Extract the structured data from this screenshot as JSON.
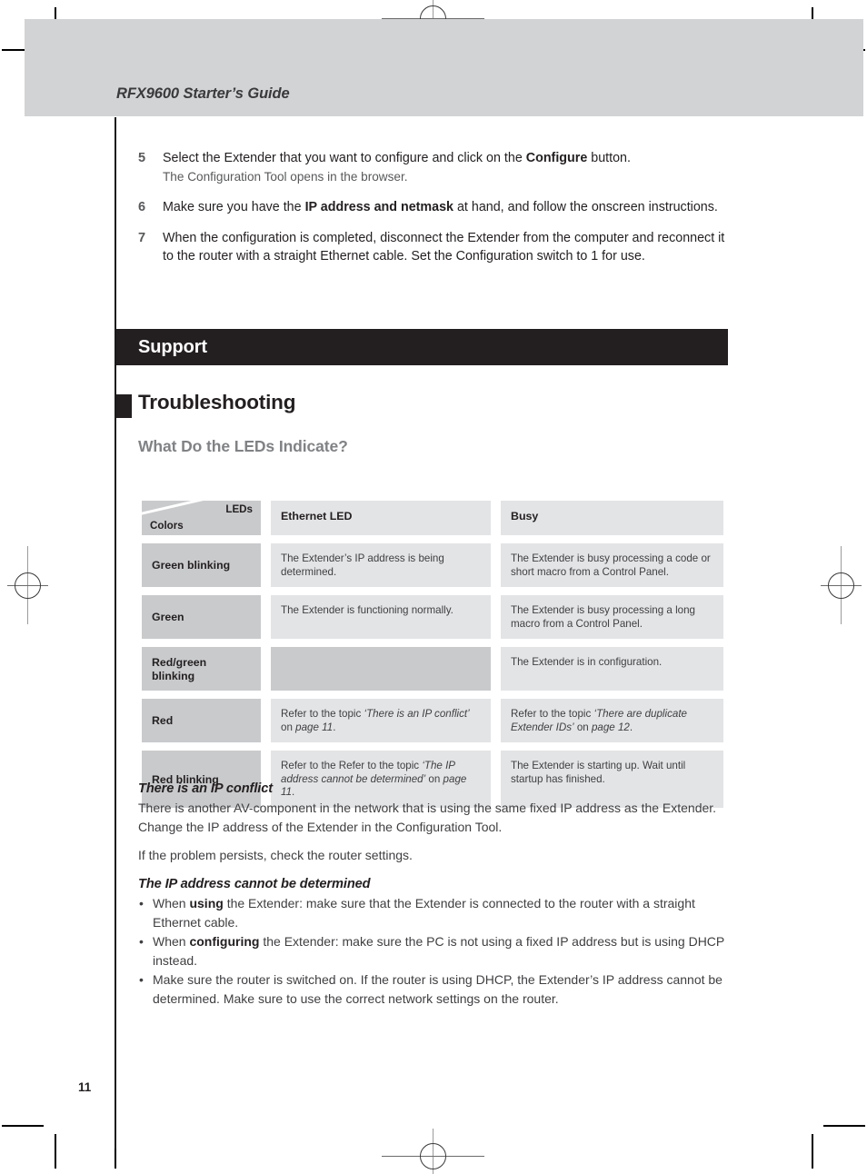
{
  "page": {
    "running_head": "RFX9600 Starter’s Guide",
    "page_number": "11"
  },
  "steps": [
    {
      "number": "5",
      "text_parts": [
        "Select the Extender that you want to configure and click on the ",
        "Configure",
        " button."
      ],
      "sub": "The Configuration Tool opens in the browser."
    },
    {
      "number": "6",
      "text_parts": [
        "Make sure you have the ",
        "IP address and netmask",
        " at hand, and follow the onscreen instructions."
      ],
      "sub": ""
    },
    {
      "number": "7",
      "text_parts": [
        "When the configuration is completed, disconnect the Extender from the computer and reconnect it to the router with a straight Ethernet cable. Set the Configuration switch to 1 for use.",
        "",
        ""
      ],
      "sub": ""
    }
  ],
  "support": {
    "bar_title": "Support",
    "h1": "Troubleshooting",
    "h2": "What Do the LEDs Indicate?"
  },
  "led_table": {
    "corner_top_right": "LEDs",
    "corner_bottom_left": "Colors",
    "columns": [
      "Ethernet LED",
      "Busy"
    ],
    "rows": [
      {
        "color": "Green blinking",
        "ethernet": "The Extender’s IP address is being determined.",
        "busy": "The Extender is busy processing a code or short macro from a Control Panel."
      },
      {
        "color": "Green",
        "ethernet": "The Extender is functioning normally.",
        "busy": "The Extender is busy processing a long macro from a Control Panel."
      },
      {
        "color": "Red/green blinking",
        "ethernet": "",
        "busy": "The Extender is in configuration."
      },
      {
        "color": "Red",
        "ethernet_pre": "Refer to the topic ",
        "ethernet_em": "‘There is an IP conflict’",
        "ethernet_mid": " on ",
        "ethernet_em2": "page 11",
        "ethernet_post": ".",
        "busy_pre": "Refer to the topic ",
        "busy_em": "‘There are duplicate Extender IDs’",
        "busy_mid": " on ",
        "busy_em2": "page 12",
        "busy_post": "."
      },
      {
        "color": "Red blinking",
        "ethernet_pre": "Refer to the Refer to the topic ",
        "ethernet_em": "‘The IP address cannot be determined’",
        "ethernet_mid": " on ",
        "ethernet_em2": "page 11",
        "ethernet_post": ".",
        "busy": "The Extender is starting up. Wait until startup has finished."
      }
    ]
  },
  "ip_conflict": {
    "heading": "There is an IP conflict",
    "para1": "There is another AV-component in the network that is using the same fixed IP address as the Extender. Change the IP address of the Extender in the Configuration Tool.",
    "para2": "If the problem persists, check the router settings."
  },
  "ip_undetermined": {
    "heading": "The IP address cannot be determined",
    "bullets": [
      {
        "pre": "When ",
        "bold": "using",
        "post": " the Extender: make sure that the Extender is connected to the router with a straight Ethernet cable."
      },
      {
        "pre": "When ",
        "bold": "configuring",
        "post": " the Extender: make sure the PC is not using a fixed IP address but is using DHCP instead."
      },
      {
        "pre": "Make sure the router is switched on. If the router is using DHCP, the Extender’s IP address cannot be determined. Make sure to use the correct network settings on the router.",
        "bold": "",
        "post": ""
      }
    ]
  }
}
